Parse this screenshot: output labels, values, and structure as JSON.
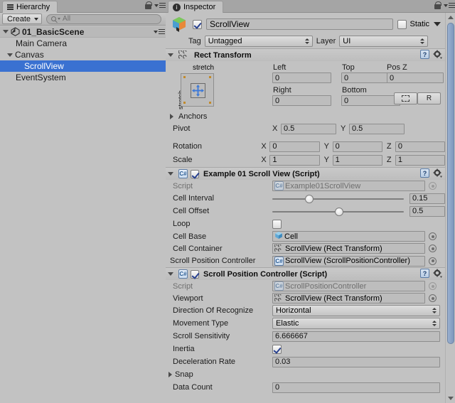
{
  "hierarchy": {
    "tab_label": "Hierarchy",
    "tab_icon": "hierarchy-icon",
    "create_button": "Create",
    "search_placeholder": "All",
    "scene_name": "01_BasicScene",
    "items": [
      {
        "label": "Main Camera",
        "depth": 1,
        "expandable": false,
        "selected": false
      },
      {
        "label": "Canvas",
        "depth": 1,
        "expandable": true,
        "expanded": true,
        "selected": false
      },
      {
        "label": "ScrollView",
        "depth": 2,
        "expandable": false,
        "selected": true
      },
      {
        "label": "EventSystem",
        "depth": 1,
        "expandable": false,
        "selected": false
      }
    ],
    "selection_color": "#3a71d1"
  },
  "inspector": {
    "tab_label": "Inspector",
    "tab_icon": "info-icon",
    "game_object": {
      "icon": "prefab-cube-icon",
      "enabled": true,
      "name": "ScrollView",
      "static_label": "Static",
      "static_checked": false,
      "tag_label": "Tag",
      "tag_value": "Untagged",
      "layer_label": "Layer",
      "layer_value": "UI"
    },
    "components": [
      {
        "id": "rect-transform",
        "title": "Rect Transform",
        "icon": "rect-transform-icon",
        "expanded": true,
        "has_toggle": false,
        "anchor_preset": {
          "top_label": "stretch",
          "left_label": "stretch"
        },
        "fields": {
          "left_label": "Left",
          "left_value": "0",
          "top_label": "Top",
          "top_value": "0",
          "posz_label": "Pos Z",
          "posz_value": "0",
          "right_label": "Right",
          "right_value": "0",
          "bottom_label": "Bottom",
          "bottom_value": "0",
          "blueprint_button": "blueprint-icon",
          "raw_button": "R",
          "anchors_label": "Anchors",
          "pivot_label": "Pivot",
          "pivot_x": "0.5",
          "pivot_y": "0.5",
          "rotation_label": "Rotation",
          "rotation_x": "0",
          "rotation_y": "0",
          "rotation_z": "0",
          "scale_label": "Scale",
          "scale_x": "1",
          "scale_y": "1",
          "scale_z": "1",
          "axis_x": "X",
          "axis_y": "Y",
          "axis_z": "Z"
        }
      },
      {
        "id": "example-01-scroll-view",
        "title": "Example 01 Scroll View (Script)",
        "icon": "csharp-script-icon",
        "expanded": true,
        "has_toggle": true,
        "enabled": true,
        "rows": [
          {
            "type": "object",
            "label": "Script",
            "value": "Example01ScrollView",
            "icon": "script-asset-icon",
            "dim": true,
            "picker": true
          },
          {
            "type": "slider",
            "label": "Cell Interval",
            "value": "0.15",
            "fraction": 0.28
          },
          {
            "type": "slider",
            "label": "Cell Offset",
            "value": "0.5",
            "fraction": 0.5
          },
          {
            "type": "checkbox",
            "label": "Loop",
            "checked": false
          },
          {
            "type": "object",
            "label": "Cell Base",
            "value": "Cell",
            "icon": "prefab-cube-icon",
            "dim": false,
            "picker": true
          },
          {
            "type": "object",
            "label": "Cell Container",
            "value": "ScrollView (Rect Transform)",
            "icon": "rect-transform-icon",
            "dim": false,
            "picker": true
          },
          {
            "type": "object",
            "label": "Scroll Position Controller",
            "value": "ScrollView (ScrollPositionController)",
            "icon": "csharp-script-icon",
            "dim": false,
            "picker": true
          }
        ]
      },
      {
        "id": "scroll-position-controller",
        "title": "Scroll Position Controller (Script)",
        "icon": "csharp-script-icon",
        "expanded": true,
        "has_toggle": true,
        "enabled": true,
        "rows": [
          {
            "type": "object",
            "label": "Script",
            "value": "ScrollPositionController",
            "icon": "script-asset-icon",
            "dim": true,
            "picker": true
          },
          {
            "type": "object",
            "label": "Viewport",
            "value": "ScrollView (Rect Transform)",
            "icon": "rect-transform-icon",
            "dim": false,
            "picker": true
          },
          {
            "type": "dropdown",
            "label": "Direction Of Recognize",
            "value": "Horizontal"
          },
          {
            "type": "dropdown",
            "label": "Movement Type",
            "value": "Elastic"
          },
          {
            "type": "text",
            "label": "Scroll Sensitivity",
            "value": "6.666667"
          },
          {
            "type": "checkbox",
            "label": "Inertia",
            "checked": true
          },
          {
            "type": "text",
            "label": "Deceleration Rate",
            "value": "0.03"
          },
          {
            "type": "foldout",
            "label": "Snap",
            "expanded": false
          },
          {
            "type": "text",
            "label": "Data Count",
            "value": "0"
          }
        ]
      }
    ]
  }
}
